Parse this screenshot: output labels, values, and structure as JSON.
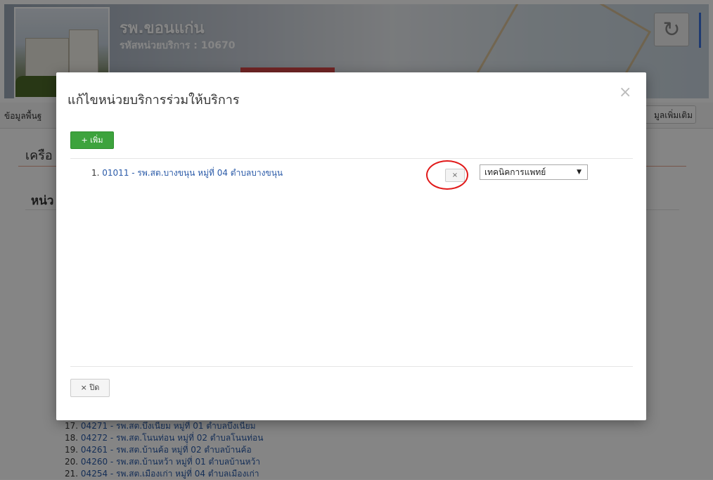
{
  "header": {
    "hospital_name": "รพ.ขอนแก่น",
    "service_code": "รหัสหน่วยบริการ : 10670",
    "refresh_icon": "refresh-icon"
  },
  "tabs": {
    "left_label": "ข้อมูลพื้นฐ",
    "right_label": "มูลเพิ่มเติม"
  },
  "background": {
    "section_title": "เครือ",
    "sub_title": "หน่ว",
    "list": [
      {
        "num": "17.",
        "text": "04271 - รพ.สต.บึงเนียม หมู่ที่ 01 ตำบลบึงเนียม"
      },
      {
        "num": "18.",
        "text": "04272 - รพ.สต.โนนท่อน หมู่ที่ 02 ตำบลโนนท่อน"
      },
      {
        "num": "19.",
        "text": "04261 - รพ.สต.บ้านค้อ หมู่ที่ 02 ตำบลบ้านค้อ"
      },
      {
        "num": "20.",
        "text": "04260 - รพ.สต.บ้านหว้า หมู่ที่ 01 ตำบลบ้านหว้า"
      },
      {
        "num": "21.",
        "text": "04254 - รพ.สต.เมืองเก่า หมู่ที่ 04 ตำบลเมืองเก่า"
      }
    ]
  },
  "modal": {
    "title": "แก้ไขหน่วยบริการร่วมให้บริการ",
    "close_glyph": "×",
    "add_label": "+ เพิ่ม",
    "items": [
      {
        "num": "1.",
        "text": "01011 - รพ.สต.บางขนุน หมู่ที่ 04 ตำบลบางขนุน",
        "remove": "×",
        "type": "เทคนิคการแพทย์"
      }
    ],
    "footer_close": "× ปิด"
  },
  "colors": {
    "add_button": "#3da33d",
    "link": "#2a5aa8",
    "annotation_circle": "#e11a1a"
  }
}
